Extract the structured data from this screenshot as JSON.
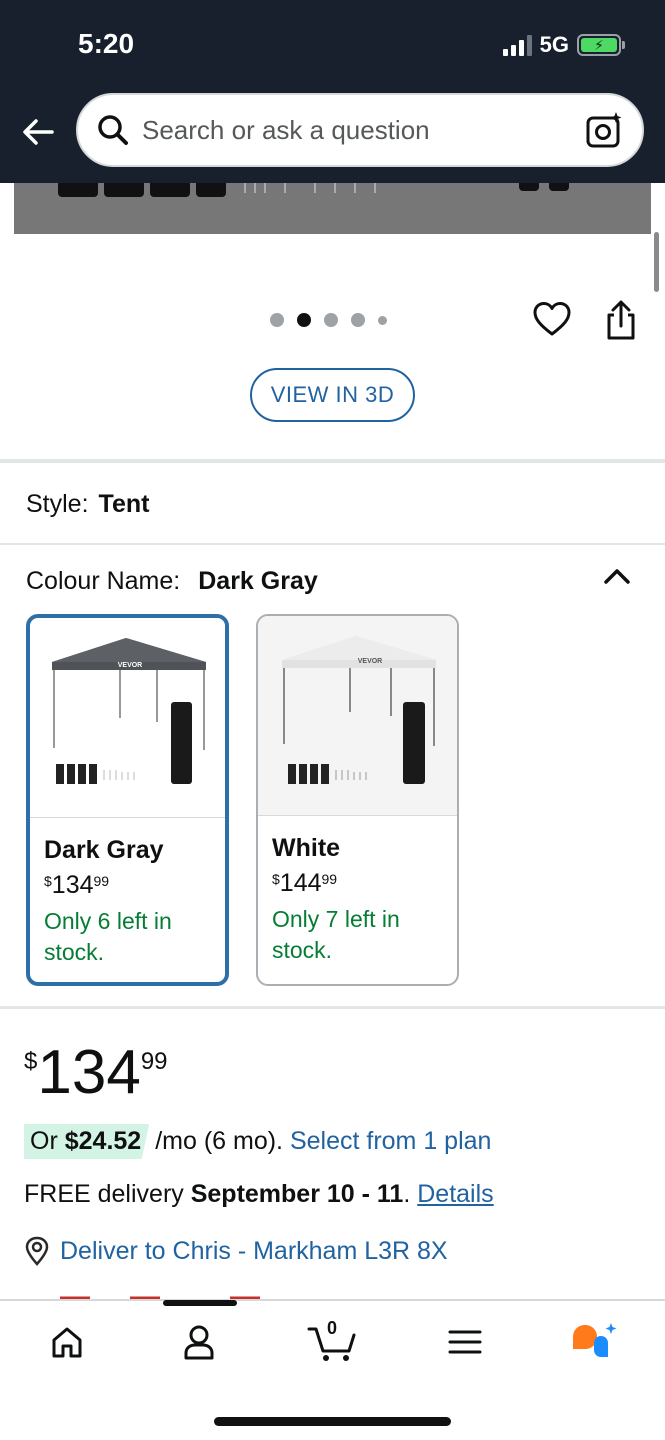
{
  "status_bar": {
    "time": "5:20",
    "network": "5G",
    "battery_icon": "battery-charging-icon"
  },
  "header": {
    "search_placeholder": "Search or ask a question",
    "back_icon": "back-arrow-icon",
    "search_icon": "search-icon",
    "camera_icon": "camera-lens-icon"
  },
  "gallery": {
    "page_count": 5,
    "active_index": 1,
    "view_3d_label": "VIEW IN 3D",
    "wishlist_icon": "heart-icon",
    "share_icon": "share-icon"
  },
  "style": {
    "label": "Style:",
    "value": "Tent"
  },
  "colour": {
    "label": "Colour Name:",
    "value": "Dark Gray",
    "options": [
      {
        "name": "Dark Gray",
        "price_symbol": "$",
        "price_whole": "134",
        "price_fraction": "99",
        "stock_line1": "Only 6 left in",
        "stock_line2": "stock.",
        "selected": true
      },
      {
        "name": "White",
        "price_symbol": "$",
        "price_whole": "144",
        "price_fraction": "99",
        "stock_line1": "Only 7 left in",
        "stock_line2": "stock.",
        "selected": false
      }
    ]
  },
  "buybox": {
    "price_symbol": "$",
    "price_whole": "134",
    "price_fraction": "99",
    "plan_prefix": "Or",
    "plan_amount": "$24.52",
    "plan_suffix": "/mo (6 mo).",
    "plan_link": "Select from 1 plan",
    "delivery_prefix": "FREE delivery",
    "delivery_dates": "September 10 - 11",
    "delivery_period": ".",
    "delivery_link": "Details",
    "deliver_to": "Deliver to Chris - Markham L3R 8X"
  },
  "bottom_nav": {
    "cart_count": "0",
    "items": [
      "home-icon",
      "account-icon",
      "cart-icon",
      "menu-icon",
      "rufus-assistant-icon"
    ]
  },
  "colors": {
    "header_bg": "#17202c",
    "link_blue": "#2162a1",
    "stock_green": "#067d34",
    "selected_border": "#2f6fa8",
    "plan_pill_bg": "#d3f4e4"
  }
}
